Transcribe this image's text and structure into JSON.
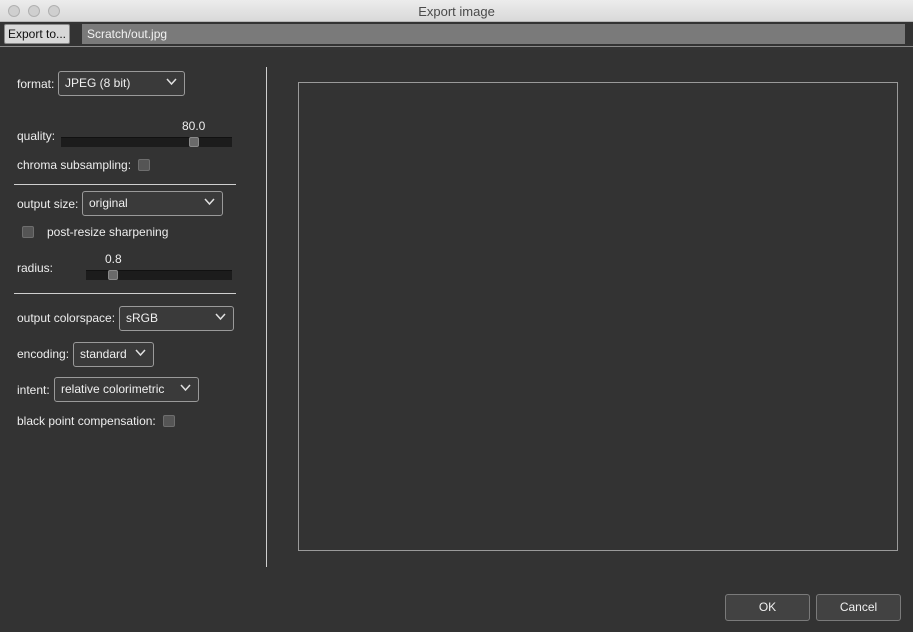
{
  "window": {
    "title": "Export image"
  },
  "toolbar": {
    "export_to_label": "Export to...",
    "path_value": "Scratch/out.jpg"
  },
  "format": {
    "label": "format:",
    "value": "JPEG (8 bit)"
  },
  "quality": {
    "label": "quality:",
    "value": "80.0",
    "fraction": 0.8
  },
  "chroma": {
    "label": "chroma subsampling:",
    "checked": false
  },
  "output_size": {
    "label": "output size:",
    "value": "original"
  },
  "post_resize": {
    "label": "post-resize sharpening",
    "checked": false
  },
  "radius": {
    "label": "radius:",
    "value": "0.8"
  },
  "colorspace": {
    "label": "output colorspace:",
    "value": "sRGB"
  },
  "encoding": {
    "label": "encoding:",
    "value": "standard"
  },
  "intent": {
    "label": "intent:",
    "value": "relative colorimetric"
  },
  "black_point": {
    "label": "black point compensation:",
    "checked": false
  },
  "buttons": {
    "ok": "OK",
    "cancel": "Cancel"
  },
  "icons": {
    "close": "close-icon",
    "minimize": "minimize-icon",
    "zoom": "zoom-icon",
    "dropdown": "chevron-down-icon"
  }
}
